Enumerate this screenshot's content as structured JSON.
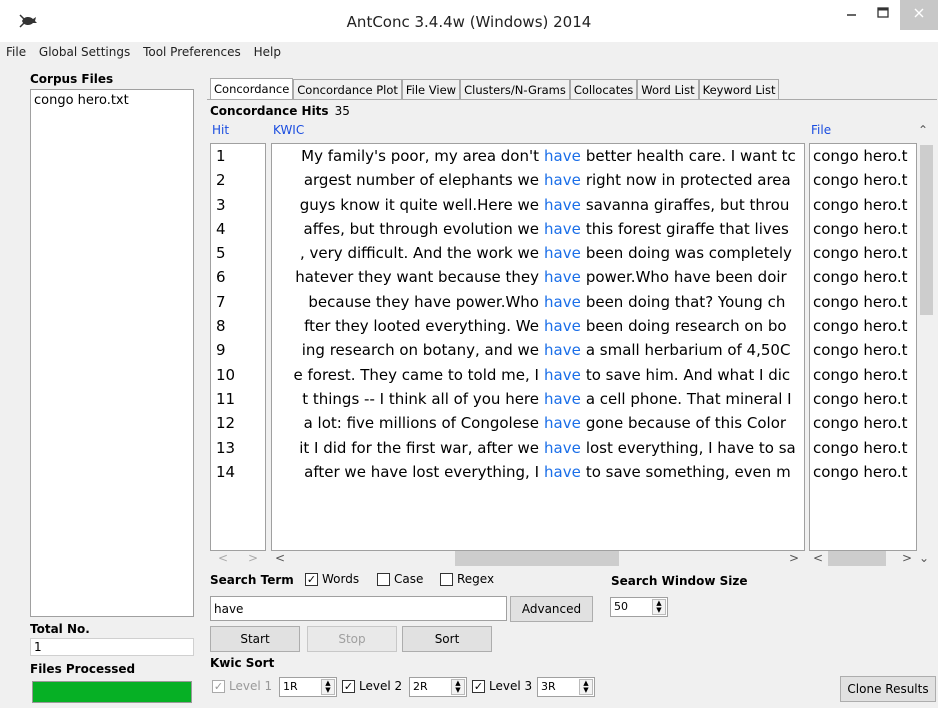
{
  "window": {
    "title": "AntConc 3.4.4w (Windows) 2014"
  },
  "menu": [
    "File",
    "Global Settings",
    "Tool Preferences",
    "Help"
  ],
  "sidebar": {
    "corpus_label": "Corpus Files",
    "files": [
      "congo hero.txt"
    ],
    "total_label": "Total No.",
    "total_value": "1",
    "processed_label": "Files Processed",
    "progress_fraction": 1.0,
    "progress_color": "#06b025"
  },
  "tabs": [
    "Concordance",
    "Concordance Plot",
    "File View",
    "Clusters/N-Grams",
    "Collocates",
    "Word List",
    "Keyword List"
  ],
  "concordance": {
    "hits_label": "Concordance Hits",
    "hits_count": "35",
    "col_hit": "Hit",
    "col_kwic": "KWIC",
    "col_file": "File",
    "keyword_color": "#1a6ee8",
    "rows": [
      {
        "hit": "1",
        "left": "My family's poor, my area don't",
        "kw": "have",
        "right": "better health care. I want tc",
        "file": "congo hero.t"
      },
      {
        "hit": "2",
        "left": "argest number of elephants we",
        "kw": "have",
        "right": "right now in protected area",
        "file": "congo hero.t"
      },
      {
        "hit": "3",
        "left": "guys know it quite well.Here we",
        "kw": "have",
        "right": "savanna giraffes, but throu",
        "file": "congo hero.t"
      },
      {
        "hit": "4",
        "left": "affes, but through evolution we",
        "kw": "have",
        "right": "this forest giraffe that lives",
        "file": "congo hero.t"
      },
      {
        "hit": "5",
        "left": ", very difficult. And the work we",
        "kw": "have",
        "right": "been doing was completely",
        "file": "congo hero.t"
      },
      {
        "hit": "6",
        "left": "hatever they want because they",
        "kw": "have",
        "right": "power.Who have been doir",
        "file": "congo hero.t"
      },
      {
        "hit": "7",
        "left": "because they have power.Who",
        "kw": "have",
        "right": "been doing that? Young ch",
        "file": "congo hero.t"
      },
      {
        "hit": "8",
        "left": "fter they looted everything. We",
        "kw": "have",
        "right": "been doing research on bo",
        "file": "congo hero.t"
      },
      {
        "hit": "9",
        "left": "ing research on botany, and we",
        "kw": "have",
        "right": "a small herbarium of 4,50C",
        "file": "congo hero.t"
      },
      {
        "hit": "10",
        "left": "e forest. They came to told me, I",
        "kw": "have",
        "right": "to save him. And what I dic",
        "file": "congo hero.t"
      },
      {
        "hit": "11",
        "left": "t things -- I think all of you here",
        "kw": "have",
        "right": "a cell phone. That mineral I",
        "file": "congo hero.t"
      },
      {
        "hit": "12",
        "left": "a lot: five millions of Congolese",
        "kw": "have",
        "right": "gone because of this Color",
        "file": "congo hero.t"
      },
      {
        "hit": "13",
        "left": "it I did for the first war, after we",
        "kw": "have",
        "right": "lost everything, I have to sa",
        "file": "congo hero.t"
      },
      {
        "hit": "14",
        "left": "after we have lost everything, I",
        "kw": "have",
        "right": "to save something, even m",
        "file": "congo hero.t"
      }
    ]
  },
  "search": {
    "label": "Search Term",
    "words_label": "Words",
    "words_checked": true,
    "case_label": "Case",
    "case_checked": false,
    "regex_label": "Regex",
    "regex_checked": false,
    "term": "have",
    "advanced_label": "Advanced",
    "window_label": "Search Window Size",
    "window_value": "50"
  },
  "buttons": {
    "start": "Start",
    "stop": "Stop",
    "sort": "Sort",
    "clone": "Clone Results"
  },
  "kwic_sort": {
    "label": "Kwic Sort",
    "level1_label": "Level 1",
    "level1_value": "1R",
    "level2_label": "Level 2",
    "level2_value": "2R",
    "level3_label": "Level 3",
    "level3_value": "3R"
  }
}
